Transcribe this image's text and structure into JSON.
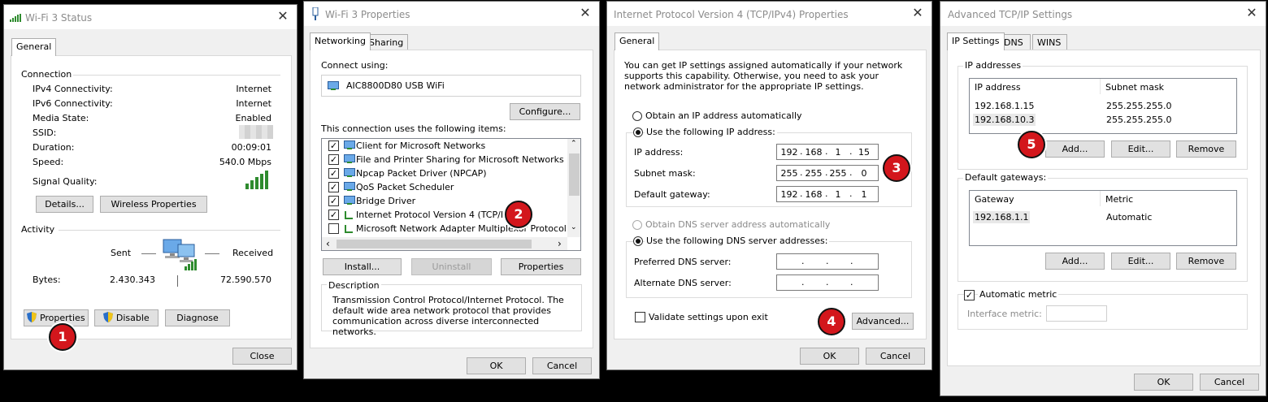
{
  "colors": {
    "badge": "#d3161c",
    "signal": "#2e8b2e",
    "titlebar": "#ffffff",
    "panel": "#f0f0f0"
  },
  "status": {
    "title": "Wi-Fi 3 Status",
    "tab": "General",
    "connection_label": "Connection",
    "rows": [
      {
        "label": "IPv4 Connectivity:",
        "value": "Internet"
      },
      {
        "label": "IPv6 Connectivity:",
        "value": "Internet"
      },
      {
        "label": "Media State:",
        "value": "Enabled"
      },
      {
        "label": "SSID:",
        "value": ""
      },
      {
        "label": "Duration:",
        "value": "00:09:01"
      },
      {
        "label": "Speed:",
        "value": "540.0 Mbps"
      }
    ],
    "signal_quality_label": "Signal Quality:",
    "details_btn": "Details...",
    "wireless_btn": "Wireless Properties",
    "activity_label": "Activity",
    "sent_label": "Sent",
    "received_label": "Received",
    "bytes_label": "Bytes:",
    "bytes_sent": "2.430.343",
    "bytes_received": "72.590.570",
    "properties_btn": "Properties",
    "disable_btn": "Disable",
    "diagnose_btn": "Diagnose",
    "close_btn": "Close"
  },
  "props": {
    "title": "Wi-Fi 3 Properties",
    "tabs": [
      "Networking",
      "Sharing"
    ],
    "connect_using": "Connect using:",
    "adapter": "AIC8800D80 USB WiFi",
    "configure_btn": "Configure...",
    "items_label": "This connection uses the following items:",
    "items": [
      {
        "label": "Client for Microsoft Networks",
        "checked": true
      },
      {
        "label": "File and Printer Sharing for Microsoft Networks",
        "checked": true
      },
      {
        "label": "Npcap Packet Driver (NPCAP)",
        "checked": true
      },
      {
        "label": "QoS Packet Scheduler",
        "checked": true
      },
      {
        "label": "Bridge Driver",
        "checked": true
      },
      {
        "label": "Internet Protocol Version 4 (TCP/IPv4)",
        "checked": true
      },
      {
        "label": "Microsoft Network Adapter Multiplexor Protocol",
        "checked": false
      }
    ],
    "install_btn": "Install...",
    "uninstall_btn": "Uninstall",
    "properties_btn": "Properties",
    "description_label": "Description",
    "description": "Transmission Control Protocol/Internet Protocol. The default wide area network protocol that provides communication across diverse interconnected networks.",
    "ok_btn": "OK",
    "cancel_btn": "Cancel"
  },
  "ipv4": {
    "title": "Internet Protocol Version 4 (TCP/IPv4) Properties",
    "tab": "General",
    "intro": "You can get IP settings assigned automatically if your network supports this capability. Otherwise, you need to ask your network administrator for the appropriate IP settings.",
    "obtain_ip": "Obtain an IP address automatically",
    "use_ip": "Use the following IP address:",
    "ip_label": "IP address:",
    "ip": [
      "192",
      "168",
      "1",
      "15"
    ],
    "mask_label": "Subnet mask:",
    "mask": [
      "255",
      "255",
      "255",
      "0"
    ],
    "gw_label": "Default gateway:",
    "gw": [
      "192",
      "168",
      "1",
      "1"
    ],
    "obtain_dns": "Obtain DNS server address automatically",
    "use_dns": "Use the following DNS server addresses:",
    "pref_dns": "Preferred DNS server:",
    "alt_dns": "Alternate DNS server:",
    "validate": "Validate settings upon exit",
    "advanced_btn": "Advanced...",
    "ok_btn": "OK",
    "cancel_btn": "Cancel"
  },
  "adv": {
    "title": "Advanced TCP/IP Settings",
    "tabs": [
      "IP Settings",
      "DNS",
      "WINS"
    ],
    "ip_group": "IP addresses",
    "col_ip": "IP address",
    "col_mask": "Subnet mask",
    "ips": [
      {
        "ip": "192.168.1.15",
        "mask": "255.255.255.0"
      },
      {
        "ip": "192.168.10.3",
        "mask": "255.255.255.0"
      }
    ],
    "add_btn": "Add...",
    "edit_btn": "Edit...",
    "remove_btn": "Remove",
    "gw_group": "Default gateways:",
    "col_gw": "Gateway",
    "col_metric": "Metric",
    "gw_rows": [
      {
        "gw": "192.168.1.1",
        "metric": "Automatic"
      }
    ],
    "auto_metric": "Automatic metric",
    "iface_metric": "Interface metric:",
    "ok_btn": "OK",
    "cancel_btn": "Cancel"
  },
  "badges": [
    "1",
    "2",
    "3",
    "4",
    "5"
  ]
}
